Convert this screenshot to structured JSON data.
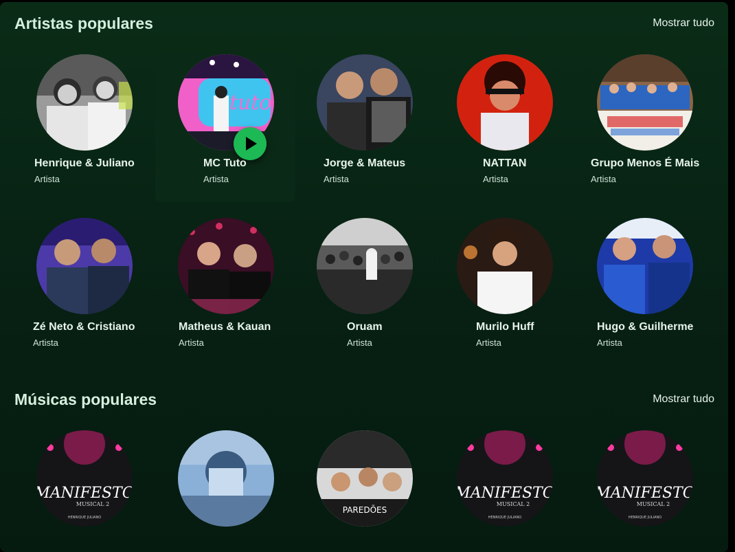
{
  "sections": [
    {
      "title": "Artistas populares",
      "show_all": "Mostrar tudo",
      "items": [
        {
          "name": "Henrique & Juliano",
          "subtitle": "Artista"
        },
        {
          "name": "MC Tuto",
          "subtitle": "Artista"
        },
        {
          "name": "Jorge & Mateus",
          "subtitle": "Artista"
        },
        {
          "name": "NATTAN",
          "subtitle": "Artista"
        },
        {
          "name": "Grupo Menos É Mais",
          "subtitle": "Artista"
        },
        {
          "name": "Zé Neto & Cristiano",
          "subtitle": "Artista"
        },
        {
          "name": "Matheus & Kauan",
          "subtitle": "Artista"
        },
        {
          "name": "Oruam",
          "subtitle": "Artista"
        },
        {
          "name": "Murilo Huff",
          "subtitle": "Artista"
        },
        {
          "name": "Hugo & Guilherme",
          "subtitle": "Artista"
        }
      ]
    },
    {
      "title": "Músicas populares",
      "show_all": "Mostrar tudo",
      "items": [
        {
          "cover_text": "MANIFESTO",
          "cover_sub": "MUSICAL 2",
          "cover_credit": "HENRIQUE JULIANO"
        },
        {
          "cover_text": "",
          "cover_sub": "",
          "cover_credit": ""
        },
        {
          "cover_text": "PAREDÕES",
          "cover_sub": "",
          "cover_credit": ""
        },
        {
          "cover_text": "MANIFESTO",
          "cover_sub": "MUSICAL 2",
          "cover_credit": "HENRIQUE JULIANO"
        },
        {
          "cover_text": "MANIFESTO",
          "cover_sub": "MUSICAL 2",
          "cover_credit": "HENRIQUE JULIANO"
        }
      ]
    }
  ],
  "colors": {
    "accent": "#1db954",
    "panel_top": "#0a2c17",
    "panel_bottom": "#061b10"
  },
  "icons": {
    "play": "play-icon"
  }
}
